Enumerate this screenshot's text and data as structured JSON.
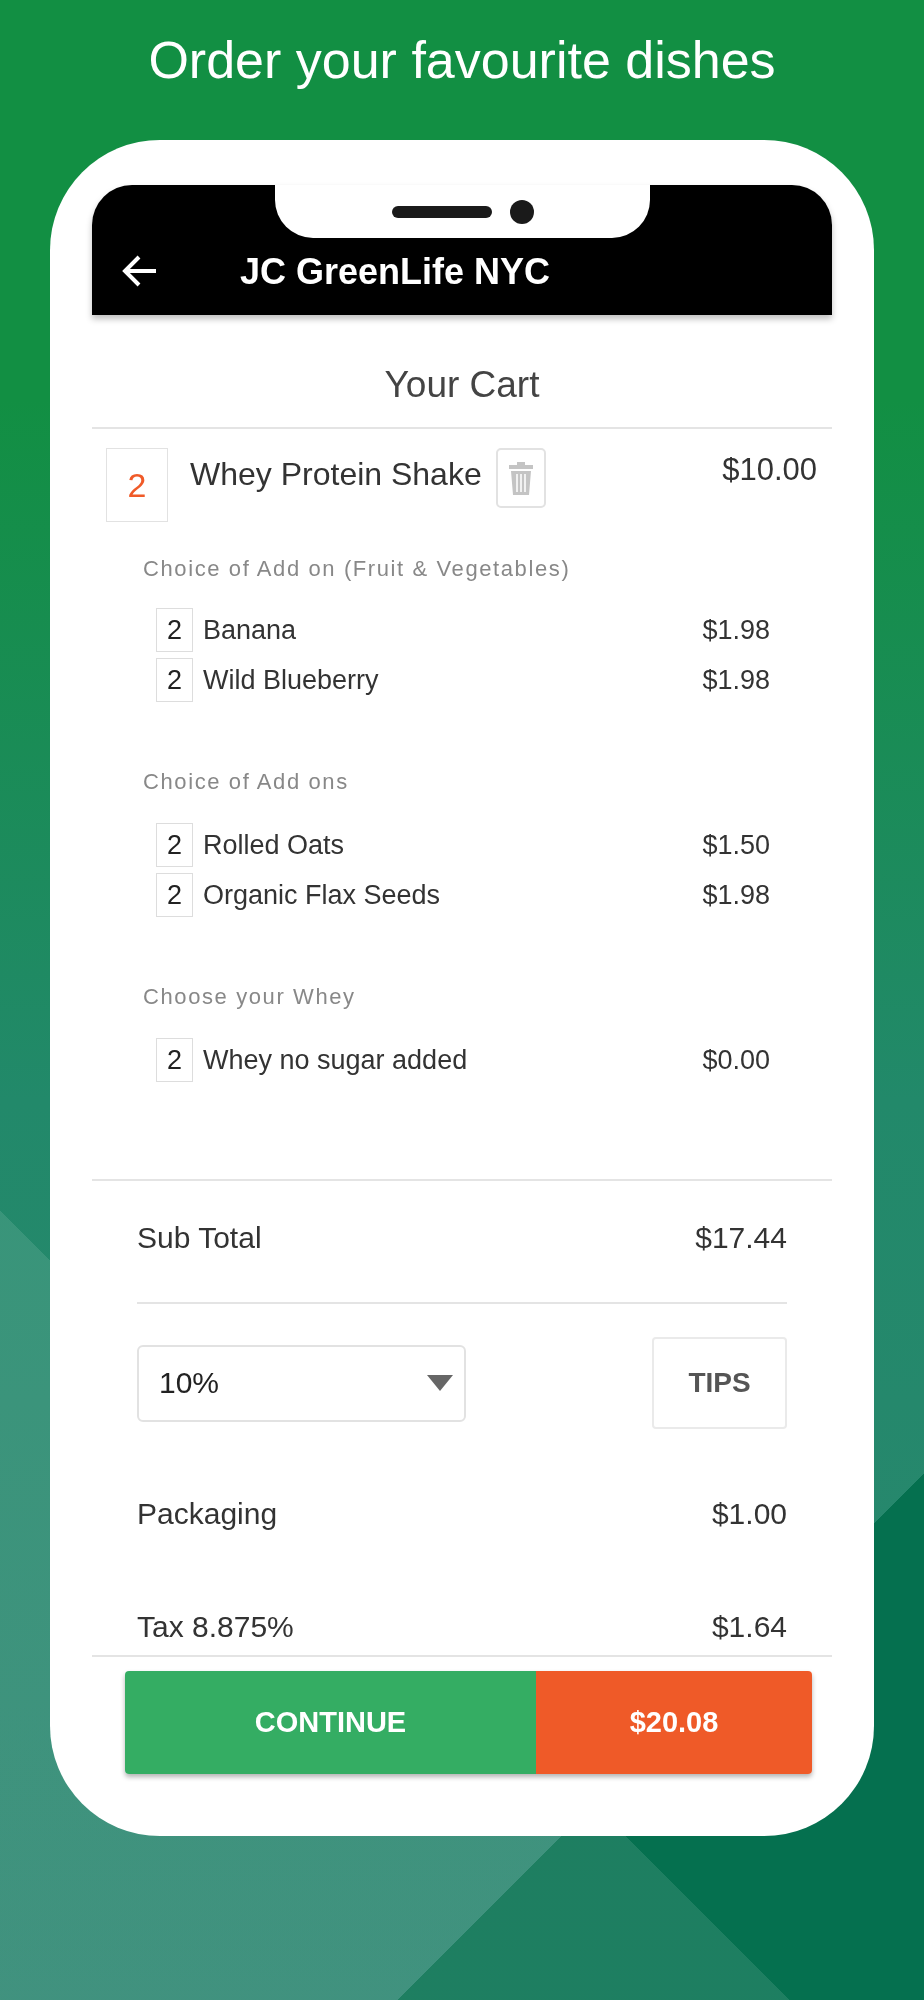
{
  "headline": "Order your favourite dishes",
  "app_bar": {
    "title": "JC GreenLife NYC"
  },
  "cart_title": "Your Cart",
  "item": {
    "quantity": "2",
    "name": "Whey Protein Shake",
    "price": "$10.00"
  },
  "option_groups": [
    {
      "label": "Choice of Add on (Fruit & Vegetables)",
      "options": [
        {
          "quantity": "2",
          "name": "Banana",
          "price": "$1.98"
        },
        {
          "quantity": "2",
          "name": "Wild Blueberry",
          "price": "$1.98"
        }
      ]
    },
    {
      "label": "Choice of Add ons",
      "options": [
        {
          "quantity": "2",
          "name": "Rolled Oats",
          "price": "$1.50"
        },
        {
          "quantity": "2",
          "name": "Organic Flax Seeds",
          "price": "$1.98"
        }
      ]
    },
    {
      "label": "Choose your Whey",
      "options": [
        {
          "quantity": "2",
          "name": "Whey no sugar added",
          "price": "$0.00"
        }
      ]
    }
  ],
  "subtotal": {
    "label": "Sub Total",
    "amount": "$17.44"
  },
  "tips": {
    "value": "10%",
    "button": "TIPS"
  },
  "charges": [
    {
      "label": "Packaging",
      "amount": "$1.00"
    },
    {
      "label": "Tax 8.875%",
      "amount": "$1.64"
    }
  ],
  "footer": {
    "continue": "CONTINUE",
    "total": "$20.08"
  }
}
